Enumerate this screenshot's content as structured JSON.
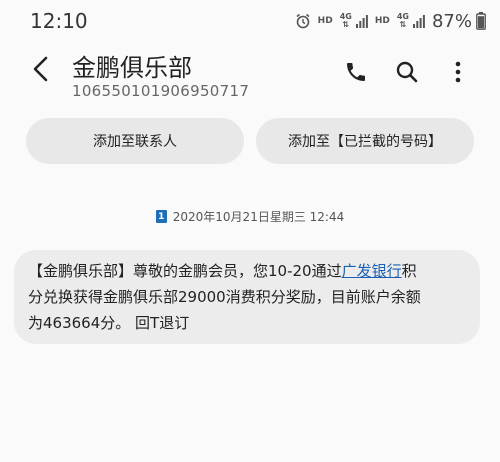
{
  "status_bar": {
    "time": "12:10",
    "hd_label": "HD",
    "network_label": "4G",
    "battery": "87%"
  },
  "header": {
    "contact_name": "金鹏俱乐部",
    "contact_number": "106550101906950717",
    "icons": [
      "back-arrow-icon",
      "phone-icon",
      "search-icon",
      "more-vertical-icon"
    ]
  },
  "actions": {
    "add_contact": "添加至联系人",
    "add_blocked": "添加至【已拦截的号码】"
  },
  "conversation": {
    "sim_label": "1",
    "date": "2020年10月21日星期三 12:44",
    "message": {
      "line1_before": "【金鹏俱乐部】尊敬的金鹏会员，您10-20通过",
      "link_text": "广发银行",
      "line1_after": "积",
      "line2": "分兑换获得金鹏俱乐部29000消费积分奖励，目前账户余额",
      "line3": "为463664分。 回T退订"
    }
  },
  "colors": {
    "accent_link": "#1a5fb4",
    "sim_badge": "#1e6fb8",
    "bubble_bg": "#ececec",
    "pill_bg": "#e8e8e8"
  }
}
